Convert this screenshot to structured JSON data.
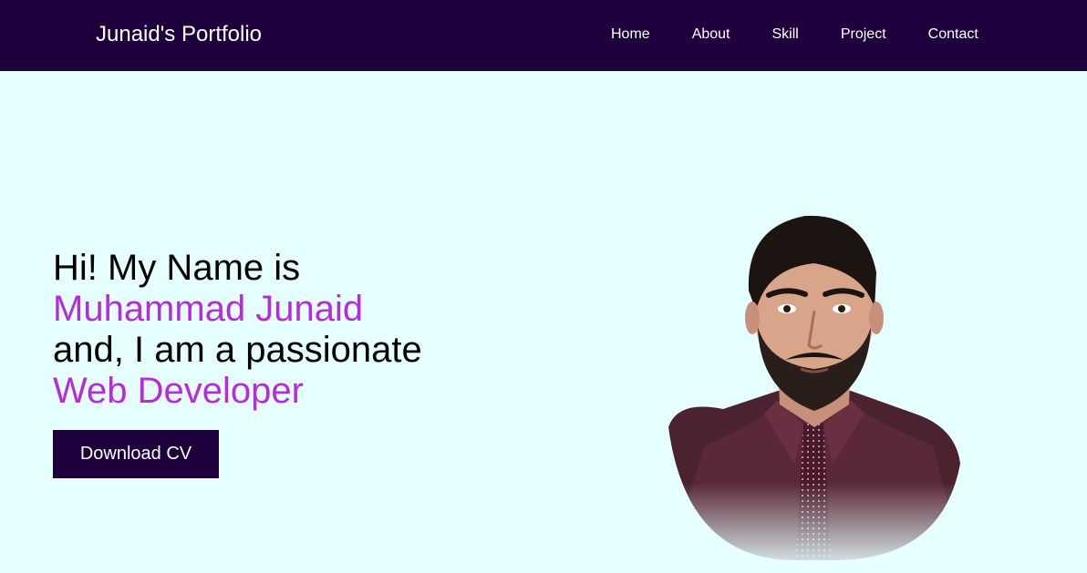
{
  "header": {
    "brand": "Junaid's Portfolio",
    "nav": [
      {
        "label": "Home"
      },
      {
        "label": "About"
      },
      {
        "label": "Skill"
      },
      {
        "label": "Project"
      },
      {
        "label": "Contact"
      }
    ]
  },
  "hero": {
    "line1": "Hi! My Name is",
    "name": "Muhammad Junaid",
    "line3": "and, I am a passionate",
    "role": "Web Developer",
    "button_label": "Download CV"
  },
  "colors": {
    "nav_bg": "#1e003c",
    "page_bg": "#e6ffff",
    "accent": "#b82ae0",
    "button_bg": "#1e003c"
  }
}
